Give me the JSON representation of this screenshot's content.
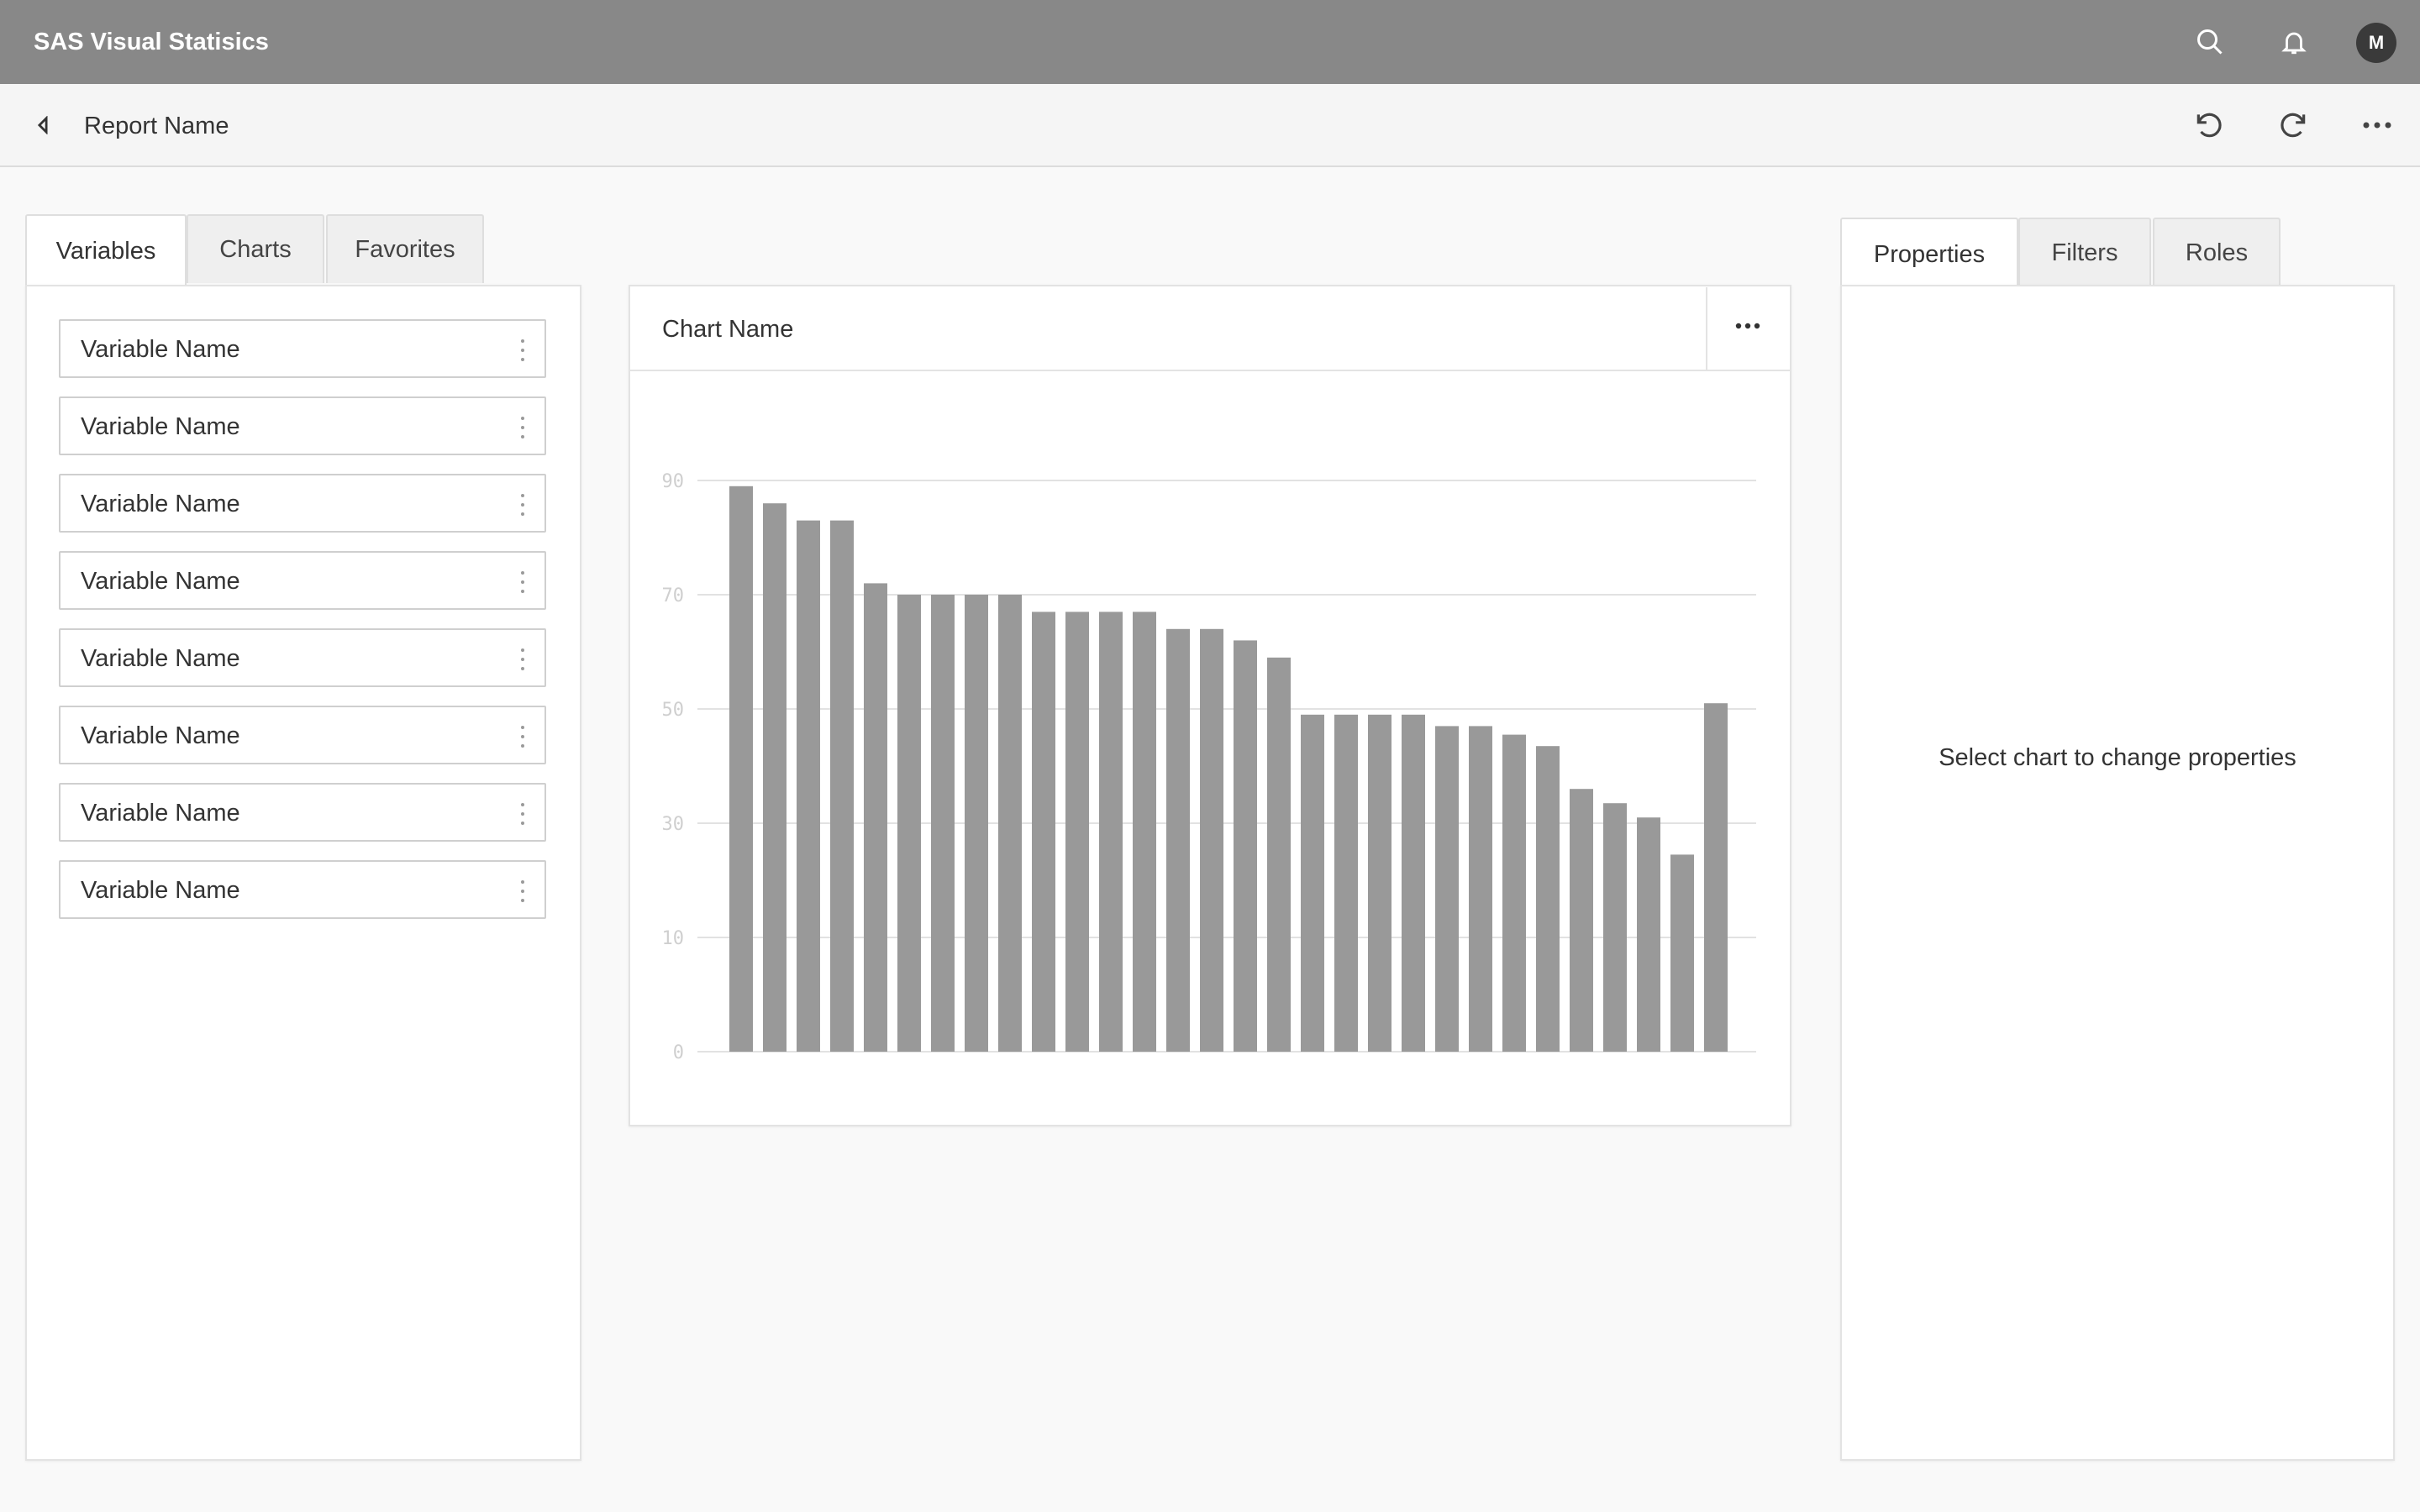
{
  "app": {
    "title": "SAS Visual Statisics",
    "user_initial": "M"
  },
  "toolbar": {
    "report_name": "Report Name"
  },
  "left_panel": {
    "tabs": [
      {
        "label": "Variables",
        "active": true
      },
      {
        "label": "Charts",
        "active": false
      },
      {
        "label": "Favorites",
        "active": false
      }
    ],
    "variables": [
      {
        "label": "Variable Name"
      },
      {
        "label": "Variable Name"
      },
      {
        "label": "Variable Name"
      },
      {
        "label": "Variable Name"
      },
      {
        "label": "Variable Name"
      },
      {
        "label": "Variable Name"
      },
      {
        "label": "Variable Name"
      },
      {
        "label": "Variable Name"
      }
    ]
  },
  "chart_card": {
    "title": "Chart Name"
  },
  "chart_data": {
    "type": "bar",
    "values": [
      89,
      86,
      83,
      83,
      72,
      70,
      70,
      70,
      70,
      67,
      67,
      67,
      67,
      64,
      64,
      62,
      59,
      49,
      49,
      49,
      49,
      47,
      47,
      45.5,
      43.5,
      36,
      33.5,
      31,
      24.5,
      51
    ],
    "y_ticks": [
      0,
      10,
      30,
      50,
      70,
      90
    ],
    "ylim": [
      0,
      90
    ],
    "grid": true,
    "bar_color": "#999999"
  },
  "right_panel": {
    "tabs": [
      {
        "label": "Properties",
        "active": true
      },
      {
        "label": "Filters",
        "active": false
      },
      {
        "label": "Roles",
        "active": false
      }
    ],
    "message": "Select chart to change properties"
  },
  "colors": {
    "appbar": "#888888",
    "toolbar": "#f5f5f5",
    "background": "#f9f9f9",
    "bar": "#999999",
    "avatar": "#3a3a3a"
  }
}
